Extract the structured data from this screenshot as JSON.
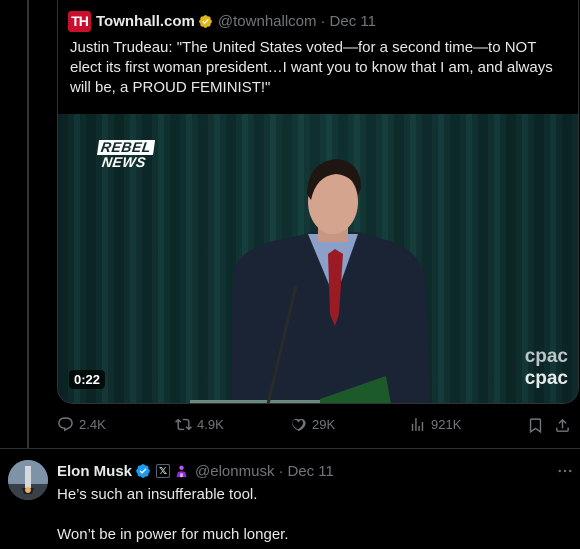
{
  "quoted_post": {
    "logo_text": "TH",
    "author_name": "Townhall.com",
    "handle": "@townhallcom",
    "separator": "·",
    "date": "Dec 11",
    "text": "Justin Trudeau: \"The United States voted—for a second time—to NOT elect its first woman president…I want you to know that I am, and always will be, a PROUD FEMINIST!\"",
    "video": {
      "duration": "0:22",
      "watermark_top": "REBEL",
      "watermark_bottom": "NEWS",
      "channel_logo_top": "cpac",
      "channel_logo_bottom": "cpac"
    }
  },
  "actions": {
    "replies": "2.4K",
    "reposts": "4.9K",
    "likes": "29K",
    "views": "921K"
  },
  "reply": {
    "author_name": "Elon Musk",
    "x_badge": "𝕏",
    "handle": "@elonmusk",
    "separator": "·",
    "date": "Dec 11",
    "line1": "He’s such an insufferable tool.",
    "line2": "Won’t be in power for much longer."
  },
  "colors": {
    "background": "#000000",
    "text_primary": "#e7e9ea",
    "text_secondary": "#71767b",
    "border": "#2f3336",
    "verified_blue": "#1d9bf0",
    "verified_gold": "#e2b719",
    "townhall_red": "#c8102e"
  }
}
